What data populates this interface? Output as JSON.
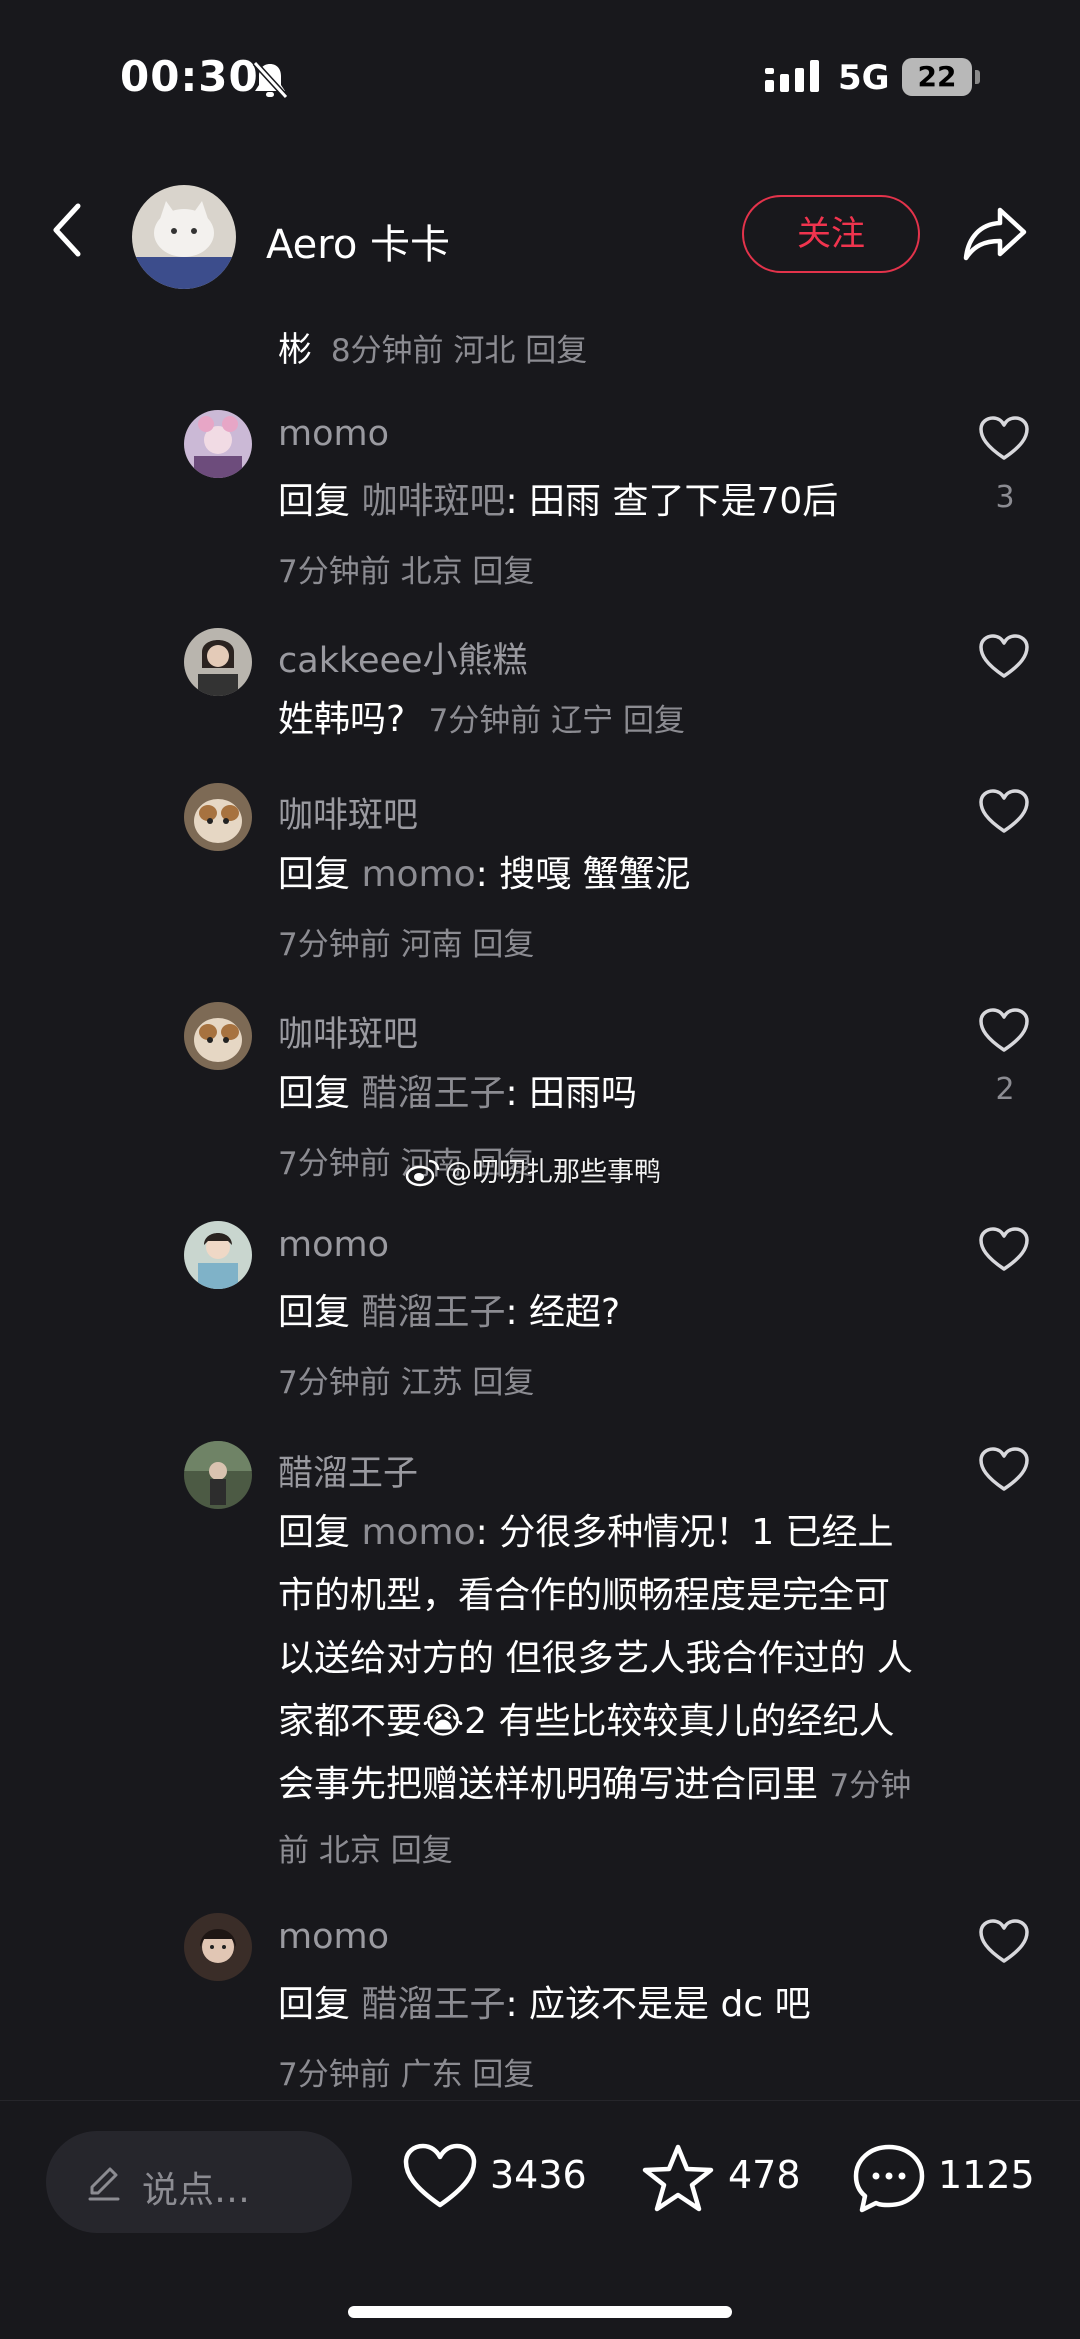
{
  "status_bar": {
    "time": "00:30",
    "network": "5G",
    "battery": "22"
  },
  "header": {
    "name": "Aero 卡卡",
    "follow_label": "关注"
  },
  "top_reply": {
    "user": "彬",
    "meta": "8分钟前 河北 回复"
  },
  "comments": [
    {
      "user": "momo",
      "reply_prefix": "回复 ",
      "reply_to": "咖啡斑吧",
      "text": ": 田雨 查了下是70后",
      "meta": "7分钟前 北京 回复",
      "likes": "3"
    },
    {
      "user": "cakkeee小熊糕",
      "text": "姓韩吗?",
      "meta": "7分钟前 辽宁 回复",
      "likes": ""
    },
    {
      "user": "咖啡斑吧",
      "reply_prefix": "回复 ",
      "reply_to": "momo",
      "text": ": 搜嘎 蟹蟹泥",
      "meta": "7分钟前 河南 回复",
      "likes": ""
    },
    {
      "user": "咖啡斑吧",
      "reply_prefix": "回复 ",
      "reply_to": "醋溜王子",
      "text": ": 田雨吗",
      "meta": "7分钟前 河南 回复",
      "likes": "2"
    },
    {
      "user": "momo",
      "reply_prefix": "回复 ",
      "reply_to": "醋溜王子",
      "text": ": 经超?",
      "meta": "7分钟前 江苏 回复",
      "likes": ""
    },
    {
      "user": "醋溜王子",
      "reply_prefix": "回复 ",
      "reply_to": "momo",
      "text": ": 分很多种情况！1 已经上市的机型，看合作的顺畅程度是完全可以送给对方的 但很多艺人我合作过的 人家都不要",
      "emoji": "😭",
      "text2": "2 有些比较较真儿的经纪人会事先把赠送样机明确写进合同里",
      "meta": "7分钟前 北京 回复",
      "likes": ""
    },
    {
      "user": "momo",
      "reply_prefix": "回复 ",
      "reply_to": "醋溜王子",
      "text": ": 应该不是是 dc 吧",
      "meta": "7分钟前 广东 回复",
      "likes": ""
    }
  ],
  "watermark": "@叨叨扎那些事鸭",
  "bottom_bar": {
    "placeholder": "说点…",
    "likes": "3436",
    "favorites": "478",
    "comments": "1125"
  },
  "colors": {
    "background": "#18181c",
    "accent": "#f0344e",
    "secondary_text": "#8c8c92"
  },
  "icons": [
    "back-icon",
    "bell-muted-icon",
    "signal-icon",
    "share-icon",
    "heart-icon",
    "star-icon",
    "comment-icon",
    "pencil-icon",
    "weibo-icon"
  ]
}
